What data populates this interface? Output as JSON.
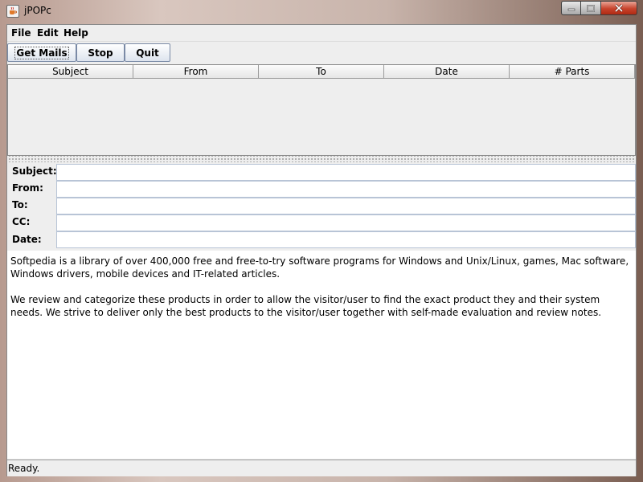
{
  "window": {
    "title": "jPOPc"
  },
  "menu": [
    {
      "label": "File"
    },
    {
      "label": "Edit"
    },
    {
      "label": "Help"
    }
  ],
  "toolbar": {
    "get_mails_label": "Get Mails",
    "stop_label": "Stop",
    "quit_label": "Quit"
  },
  "table": {
    "columns": [
      "Subject",
      "From",
      "To",
      "Date",
      "# Parts"
    ],
    "rows": []
  },
  "message_header": {
    "subject_label": "Subject:",
    "from_label": "From:",
    "to_label": "To:",
    "cc_label": "CC:",
    "date_label": "Date:",
    "subject_value": "",
    "from_value": "",
    "to_value": "",
    "cc_value": "",
    "date_value": ""
  },
  "message_body": {
    "paragraph1": "Softpedia is a library of over 400,000 free and free-to-try software programs for Windows and Unix/Linux, games, Mac software, Windows drivers, mobile devices and IT-related articles.",
    "paragraph2": "We review and categorize these products in order to allow the visitor/user to find the exact product they and their system needs. We strive to deliver only the best products to the visitor/user together with self-made evaluation and review notes."
  },
  "status": {
    "text": "Ready."
  },
  "icons": {
    "app": "java-cup-icon",
    "minimize": "minimize-icon",
    "maximize": "maximize-icon",
    "close": "close-icon"
  },
  "colors": {
    "close_button": "#c7432c",
    "field_border": "#b8c4d6",
    "panel_background": "#eeeeee"
  }
}
